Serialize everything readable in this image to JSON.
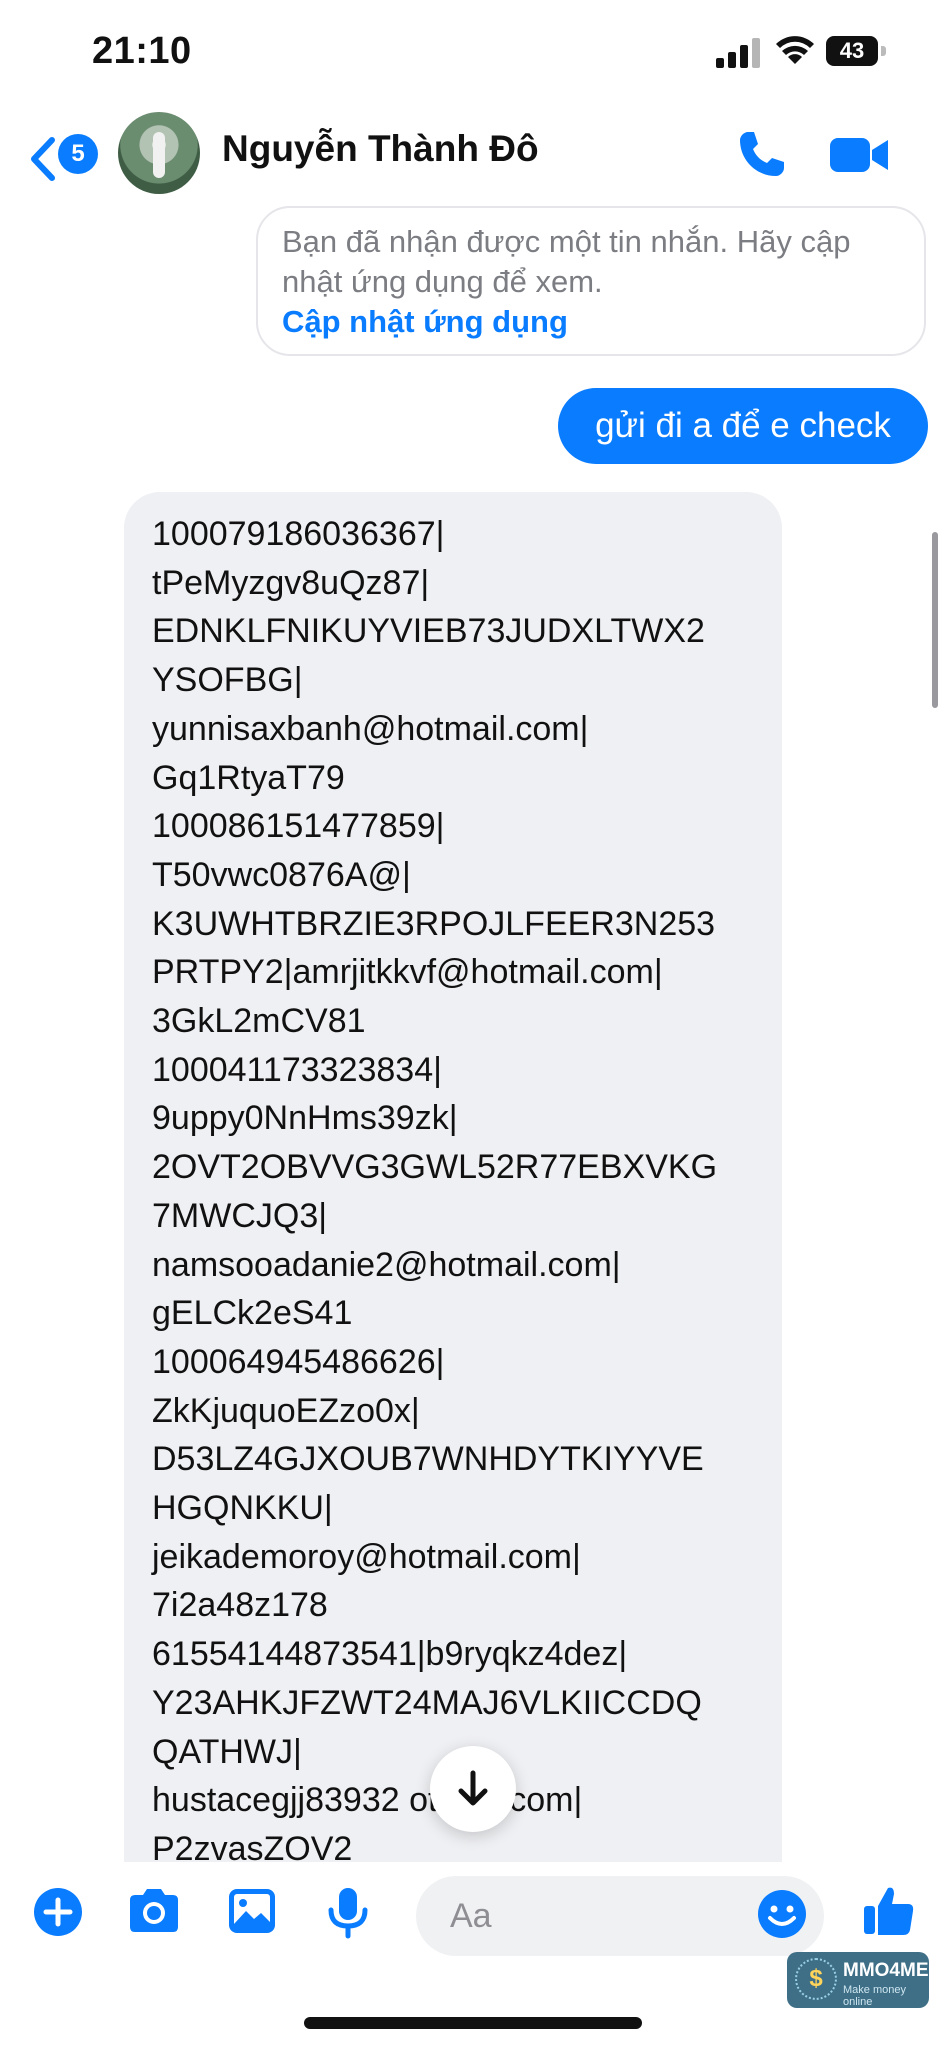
{
  "status_bar": {
    "time": "21:10",
    "battery": "43"
  },
  "header": {
    "back_badge": "5",
    "contact_name": "Nguyễn Thành Đô"
  },
  "messages": {
    "system_notice": {
      "text_line1": "Bạn đã nhận được một tin nhắn. Hãy cập",
      "text_line2": "nhật ứng dụng để xem.",
      "link": "Cập nhật ứng dụng"
    },
    "outgoing": "gửi đi a để e check",
    "incoming_lines": [
      "100079186036367|",
      "tPeMyzgv8uQz87|",
      "EDNKLFNIKUYVIEB73JUDXLTWX2",
      "YSOFBG|",
      "yunnisaxbanh@hotmail.com|",
      "Gq1RtyaT79",
      "100086151477859|",
      "T50vwc0876A@|",
      "K3UWHTBRZIE3RPOJLFEER3N253",
      "PRTPY2|amrjitkkvf@hotmail.com|",
      "3GkL2mCV81",
      "100041173323834|",
      "9uppy0NnHms39zk|",
      "2OVT2OBVVG3GWL52R77EBXVKG",
      "7MWCJQ3|",
      "namsooadanie2@hotmail.com|",
      "gELCk2eS41",
      "100064945486626|",
      "ZkKjuquoEZzo0x|",
      "D53LZ4GJXOUB7WNHDYTKIYYVE",
      "HGQNKKU|",
      "jeikademoroy@hotmail.com|",
      "7i2a48z178",
      "61554144873541|b9ryqkz4dez|",
      "Y23AHKJFZWT24MAJ6VLKIICCDQ",
      "QATHWJ|",
      "hustacegjj83932 otmail.com|",
      "P2zvasZOV2"
    ]
  },
  "composer": {
    "placeholder": "Aa"
  },
  "watermark": {
    "name": "MMO4ME",
    "tagline": "Make money online"
  },
  "colors": {
    "accent": "#0a7cff",
    "incoming_bubble": "#eff0f3"
  }
}
